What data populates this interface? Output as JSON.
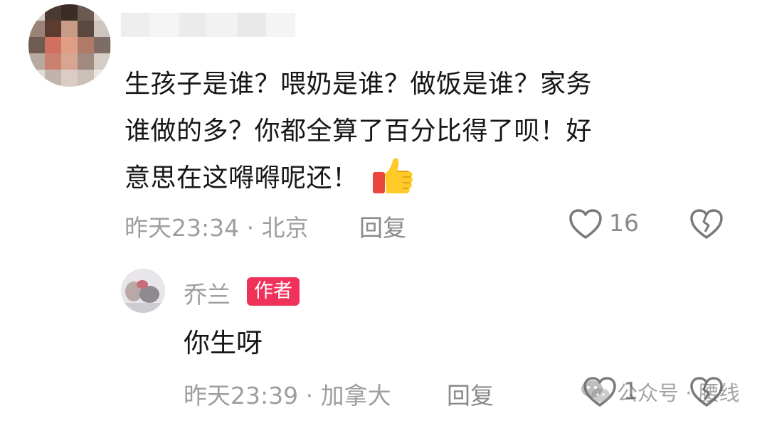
{
  "comment": {
    "lines": [
      "生孩子是谁？喂奶是谁？做饭是谁？家务",
      "谁做的多？你都全算了百分比得了呗！好",
      "意思在这嘚嘚呢还！"
    ],
    "emoji": "thumbs-up-icon",
    "time": "昨天23:34",
    "separator": "·",
    "location": "北京",
    "reply_label": "回复",
    "like_count": "16"
  },
  "reply": {
    "username": "乔兰",
    "badge": "作者",
    "text": "你生呀",
    "time": "昨天23:39",
    "separator": "·",
    "location": "加拿大",
    "reply_label": "回复",
    "like_count": "1"
  },
  "watermark": {
    "text": "公众号 · 腰线"
  },
  "colors": {
    "text": "#161616",
    "meta": "#9e9e9e",
    "badge": "#f0325a"
  }
}
